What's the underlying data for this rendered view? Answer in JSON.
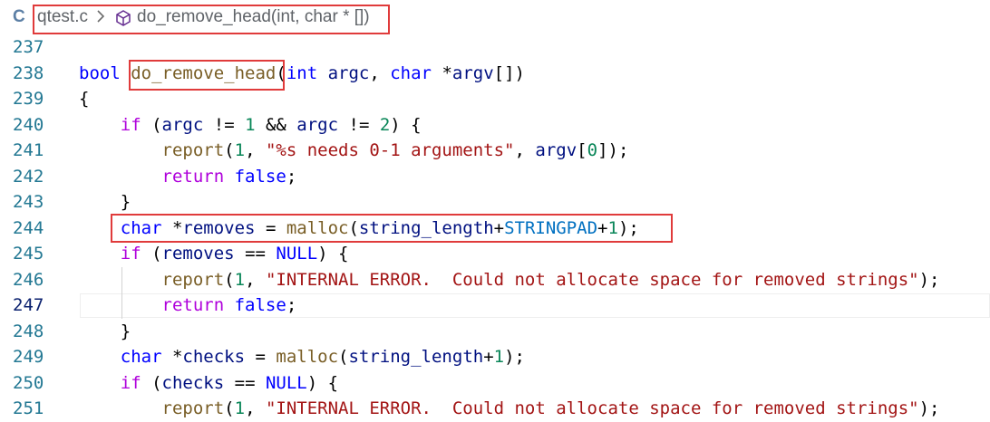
{
  "breadcrumb": {
    "lang_icon": "C",
    "file": "qtest.c",
    "separator": ">",
    "symbol_icon": "cube-icon",
    "symbol": "do_remove_head(int, char * [])"
  },
  "editor": {
    "active_line": "247",
    "lines": [
      {
        "num": "237",
        "tokens": []
      },
      {
        "num": "238",
        "tokens": [
          [
            "kw",
            "bool "
          ],
          [
            "fn",
            "do_remove_head"
          ],
          [
            "plain",
            "("
          ],
          [
            "kw",
            "int "
          ],
          [
            "var",
            "argc"
          ],
          [
            "plain",
            ", "
          ],
          [
            "kw",
            "char "
          ],
          [
            "plain",
            "*"
          ],
          [
            "var",
            "argv"
          ],
          [
            "plain",
            "[])"
          ]
        ]
      },
      {
        "num": "239",
        "tokens": [
          [
            "plain",
            "{"
          ]
        ]
      },
      {
        "num": "240",
        "tokens": [
          [
            "plain",
            "    "
          ],
          [
            "ctrl",
            "if"
          ],
          [
            "plain",
            " ("
          ],
          [
            "var",
            "argc"
          ],
          [
            "plain",
            " != "
          ],
          [
            "num",
            "1"
          ],
          [
            "plain",
            " && "
          ],
          [
            "var",
            "argc"
          ],
          [
            "plain",
            " != "
          ],
          [
            "num",
            "2"
          ],
          [
            "plain",
            ") {"
          ]
        ]
      },
      {
        "num": "241",
        "tokens": [
          [
            "plain",
            "        "
          ],
          [
            "fn",
            "report"
          ],
          [
            "plain",
            "("
          ],
          [
            "num",
            "1"
          ],
          [
            "plain",
            ", "
          ],
          [
            "str",
            "\"%s needs 0-1 arguments\""
          ],
          [
            "plain",
            ", "
          ],
          [
            "var",
            "argv"
          ],
          [
            "plain",
            "["
          ],
          [
            "num",
            "0"
          ],
          [
            "plain",
            "]);"
          ]
        ]
      },
      {
        "num": "242",
        "tokens": [
          [
            "plain",
            "        "
          ],
          [
            "ctrl",
            "return"
          ],
          [
            "plain",
            " "
          ],
          [
            "kw",
            "false"
          ],
          [
            "plain",
            ";"
          ]
        ]
      },
      {
        "num": "243",
        "tokens": [
          [
            "plain",
            "    }"
          ]
        ]
      },
      {
        "num": "244",
        "tokens": [
          [
            "plain",
            "    "
          ],
          [
            "kw",
            "char "
          ],
          [
            "plain",
            "*"
          ],
          [
            "var",
            "removes"
          ],
          [
            "plain",
            " = "
          ],
          [
            "fn",
            "malloc"
          ],
          [
            "plain",
            "("
          ],
          [
            "var",
            "string_length"
          ],
          [
            "plain",
            "+"
          ],
          [
            "mac",
            "STRINGPAD"
          ],
          [
            "plain",
            "+"
          ],
          [
            "num",
            "1"
          ],
          [
            "plain",
            ");"
          ]
        ]
      },
      {
        "num": "245",
        "tokens": [
          [
            "plain",
            "    "
          ],
          [
            "ctrl",
            "if"
          ],
          [
            "plain",
            " ("
          ],
          [
            "var",
            "removes"
          ],
          [
            "plain",
            " == "
          ],
          [
            "kw",
            "NULL"
          ],
          [
            "plain",
            ") {"
          ]
        ]
      },
      {
        "num": "246",
        "tokens": [
          [
            "plain",
            "        "
          ],
          [
            "fn",
            "report"
          ],
          [
            "plain",
            "("
          ],
          [
            "num",
            "1"
          ],
          [
            "plain",
            ", "
          ],
          [
            "str",
            "\"INTERNAL ERROR.  Could not allocate space for removed strings\""
          ],
          [
            "plain",
            ");"
          ]
        ]
      },
      {
        "num": "247",
        "tokens": [
          [
            "plain",
            "        "
          ],
          [
            "ctrl",
            "return"
          ],
          [
            "plain",
            " "
          ],
          [
            "kw",
            "false"
          ],
          [
            "plain",
            ";"
          ]
        ]
      },
      {
        "num": "248",
        "tokens": [
          [
            "plain",
            "    }"
          ]
        ]
      },
      {
        "num": "249",
        "tokens": [
          [
            "plain",
            "    "
          ],
          [
            "kw",
            "char "
          ],
          [
            "plain",
            "*"
          ],
          [
            "var",
            "checks"
          ],
          [
            "plain",
            " = "
          ],
          [
            "fn",
            "malloc"
          ],
          [
            "plain",
            "("
          ],
          [
            "var",
            "string_length"
          ],
          [
            "plain",
            "+"
          ],
          [
            "num",
            "1"
          ],
          [
            "plain",
            ");"
          ]
        ]
      },
      {
        "num": "250",
        "tokens": [
          [
            "plain",
            "    "
          ],
          [
            "ctrl",
            "if"
          ],
          [
            "plain",
            " ("
          ],
          [
            "var",
            "checks"
          ],
          [
            "plain",
            " == "
          ],
          [
            "kw",
            "NULL"
          ],
          [
            "plain",
            ") {"
          ]
        ]
      },
      {
        "num": "251",
        "tokens": [
          [
            "plain",
            "        "
          ],
          [
            "fn",
            "report"
          ],
          [
            "plain",
            "("
          ],
          [
            "num",
            "1"
          ],
          [
            "plain",
            ", "
          ],
          [
            "str",
            "\"INTERNAL ERROR.  Could not allocate space for removed strings\""
          ],
          [
            "plain",
            ");"
          ]
        ]
      }
    ]
  },
  "colors": {
    "highlight_box": "#e03b3b",
    "line_number": "#237893",
    "keyword": "#0000ff",
    "control": "#af00db",
    "function": "#795e26",
    "string": "#a31515",
    "number": "#098658",
    "variable": "#001080"
  }
}
